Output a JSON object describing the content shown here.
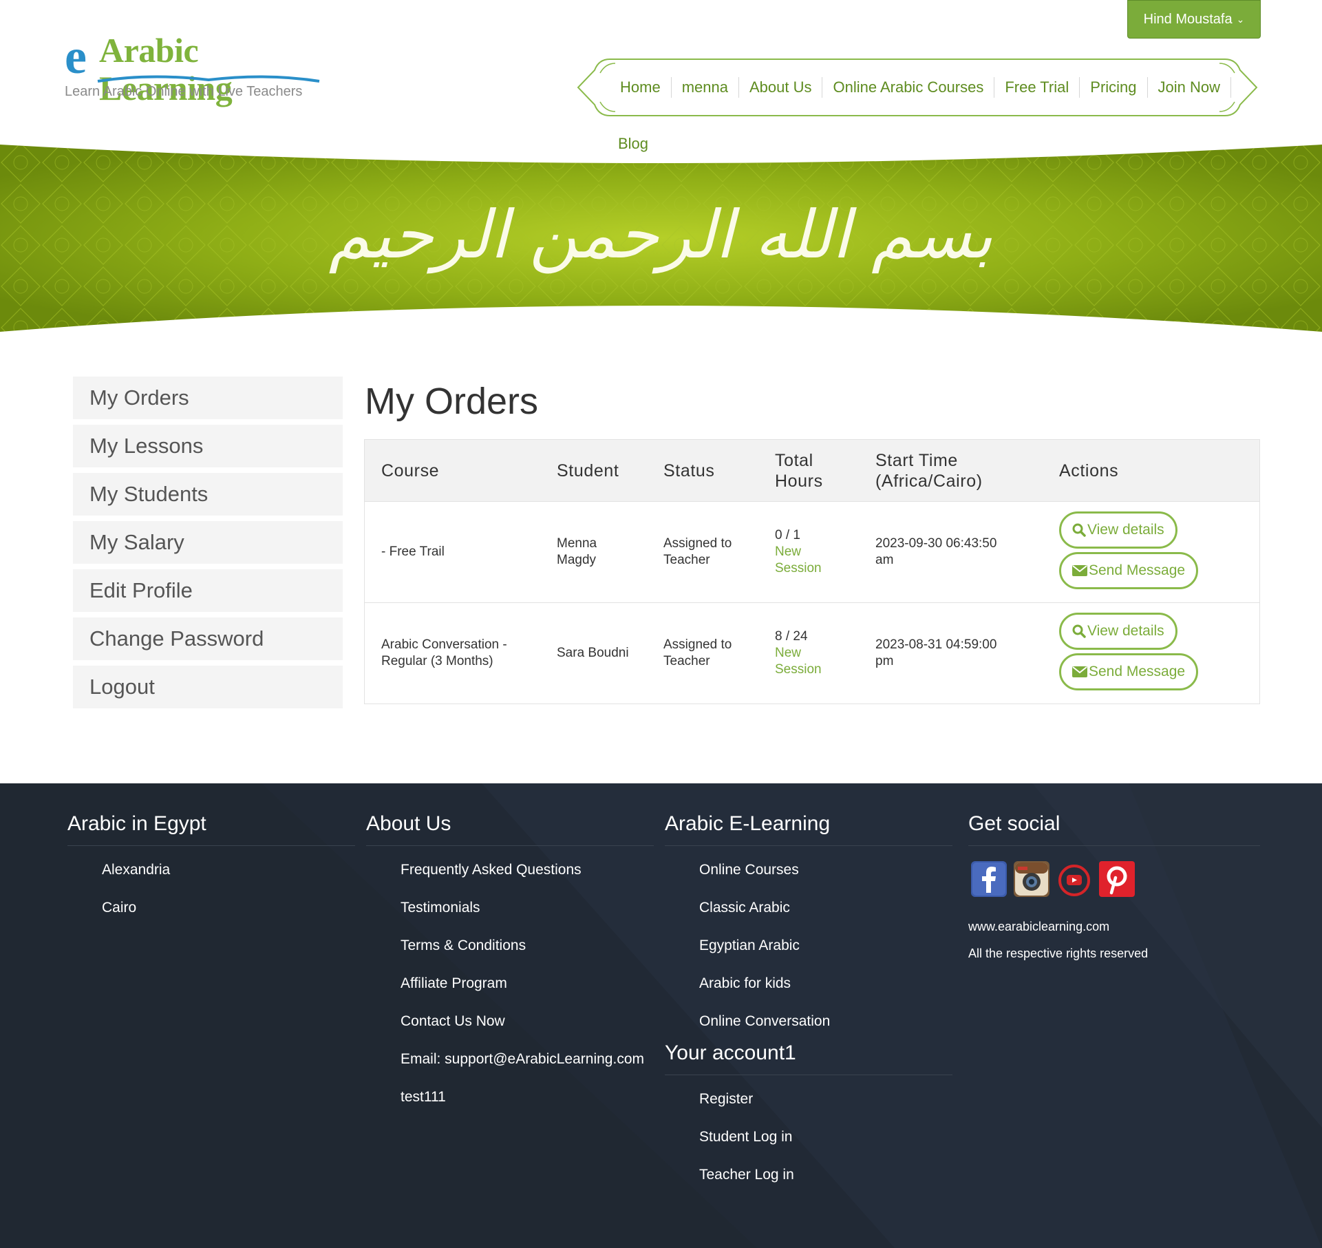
{
  "brand": {
    "logo_e": "e",
    "logo_title": "Arabic Learning",
    "tagline": "Learn Arabic Online with Live Teachers"
  },
  "user_menu": {
    "label": "Hind Moustafa",
    "icon": "chevron-down-icon"
  },
  "nav": {
    "items": [
      {
        "label": "Home"
      },
      {
        "label": "menna"
      },
      {
        "label": "About Us"
      },
      {
        "label": "Online Arabic Courses"
      },
      {
        "label": "Free Trial"
      },
      {
        "label": "Pricing"
      },
      {
        "label": "Join Now"
      }
    ],
    "blog": "Blog"
  },
  "banner": {
    "calligraphy": "بسم الله الرحمن الرحيم"
  },
  "sidebar": {
    "items": [
      {
        "label": "My Orders"
      },
      {
        "label": "My Lessons"
      },
      {
        "label": "My Students"
      },
      {
        "label": "My Salary"
      },
      {
        "label": "Edit Profile"
      },
      {
        "label": "Change Password"
      },
      {
        "label": "Logout"
      }
    ]
  },
  "main": {
    "title": "My Orders",
    "table": {
      "headers": {
        "course": "Course",
        "student": "Student",
        "status": "Status",
        "total_hours_1": "Total",
        "total_hours_2": "Hours",
        "start_time_1": "Start Time",
        "start_time_2": "(Africa/Cairo)",
        "actions": "Actions"
      },
      "rows": [
        {
          "course_1": "- Free Trail",
          "course_2": "",
          "student_1": "Menna",
          "student_2": "Magdy",
          "status_1": "Assigned to",
          "status_2": "Teacher",
          "hours": "0 / 1",
          "new_session_1": "New",
          "new_session_2": "Session",
          "start_1": "2023-09-30 06:43:50",
          "start_2": "am",
          "view_label": "View details",
          "message_label": "Send Message"
        },
        {
          "course_1": "Arabic Conversation -",
          "course_2": "Regular (3 Months)",
          "student_1": "Sara Boudni",
          "student_2": "",
          "status_1": "Assigned to",
          "status_2": "Teacher",
          "hours": "8 / 24",
          "new_session_1": "New",
          "new_session_2": "Session",
          "start_1": "2023-08-31 04:59:00",
          "start_2": "pm",
          "view_label": "View details",
          "message_label": "Send Message"
        }
      ]
    }
  },
  "footer": {
    "col1": {
      "title": "Arabic in Egypt",
      "links": [
        "Alexandria",
        "Cairo"
      ]
    },
    "col2": {
      "title": "About Us",
      "links": [
        "Frequently Asked Questions",
        "Testimonials",
        "Terms & Conditions",
        "Affiliate Program",
        "Contact Us Now",
        "Email: support@eArabicLearning.com",
        "test111"
      ]
    },
    "col3": {
      "title": "Arabic E-Learning",
      "links": [
        "Online Courses",
        "Classic Arabic",
        "Egyptian Arabic",
        "Arabic for kids",
        "Online Conversation"
      ]
    },
    "col3b": {
      "title": "Your account1",
      "links": [
        "Register",
        "Student Log in",
        "Teacher Log in"
      ]
    },
    "col4": {
      "title": "Get social",
      "icons": [
        "facebook-icon",
        "instagram-icon",
        "youtube-icon",
        "pinterest-icon"
      ],
      "site": "www.earabiclearning.com",
      "rights": "All the respective rights reserved"
    }
  },
  "colors": {
    "brand_green": "#7bac3a",
    "link_green": "#5e8c20",
    "footer_bg": "#222a35",
    "logo_blue": "#2a8fc9"
  }
}
